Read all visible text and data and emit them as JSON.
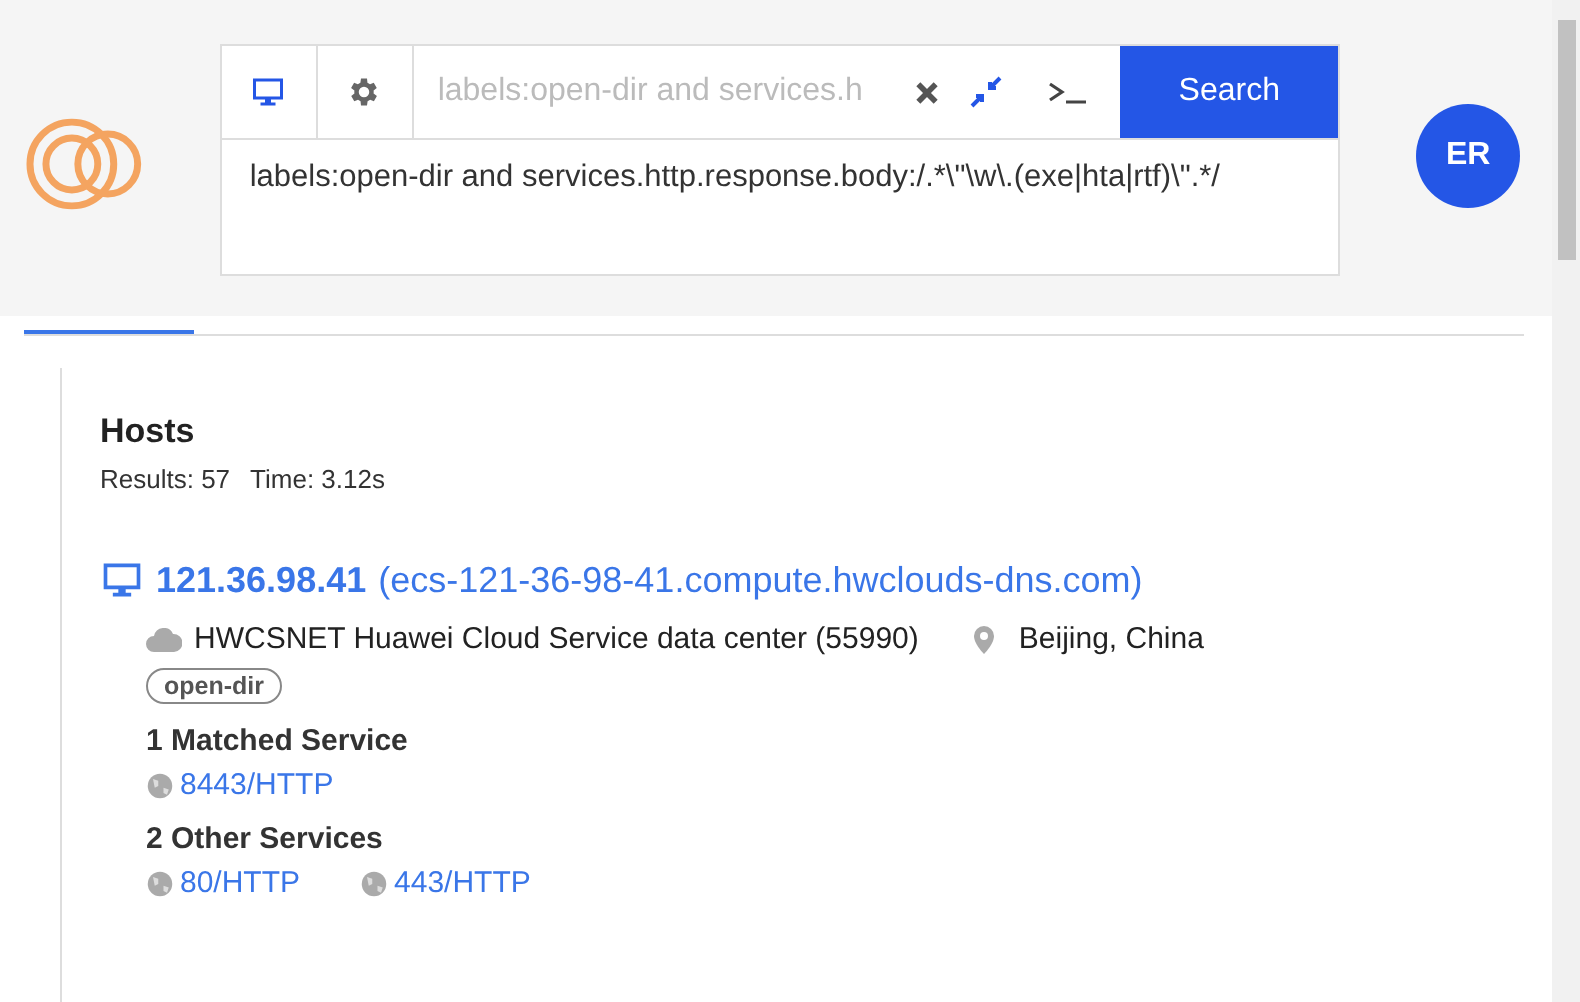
{
  "search": {
    "modes": [
      {
        "kind": "monitor",
        "selected": true
      },
      {
        "kind": "gear",
        "selected": false
      }
    ],
    "placeholder": "labels:open-dir and services.h",
    "query": "labels:open-dir and services.http.response.body:/.*\\\"\\w\\.(exe|hta|rtf)\\\".*/",
    "button": "Search"
  },
  "user": {
    "initials": "ER"
  },
  "tabs": [
    {
      "selected": true
    }
  ],
  "results": {
    "title": "Hosts",
    "count": "Results: 57",
    "time": "Time: 3.12s",
    "hosts": [
      {
        "ip": "121.36.98.41",
        "hostname": "(ecs-121-36-98-41.compute.hwclouds-dns.com)",
        "network": "HWCSNET Huawei Cloud Service data center (55990)",
        "location": "Beijing, China",
        "labels": [
          "open-dir"
        ],
        "matched_title": "1 Matched Service",
        "matched": [
          "8443/HTTP"
        ],
        "other_title": "2 Other Services",
        "other": [
          "80/HTTP",
          "443/HTTP"
        ]
      }
    ]
  }
}
